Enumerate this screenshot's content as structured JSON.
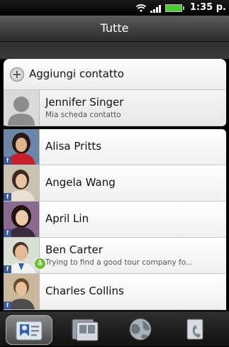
{
  "status_bar": {
    "time": "1:35 p."
  },
  "header": {
    "title": "Tutte"
  },
  "add_contact": {
    "label": "Aggiungi contatto"
  },
  "contacts": [
    {
      "name": "Jennifer Singer",
      "subtitle": "Mia scheda contatto",
      "source": "",
      "badge": ""
    },
    {
      "name": "Alisa Pritts",
      "subtitle": "",
      "source": "f",
      "badge": ""
    },
    {
      "name": "Angela Wang",
      "subtitle": "",
      "source": "f",
      "badge": ""
    },
    {
      "name": "April  Lin",
      "subtitle": "",
      "source": "f",
      "badge": ""
    },
    {
      "name": "Ben  Carter",
      "subtitle": "Trying to find a good tour company fo...",
      "source": "f",
      "badge": "1"
    },
    {
      "name": "Charles  Collins",
      "subtitle": "",
      "source": "f",
      "badge": ""
    }
  ],
  "bottom_tabs": [
    {
      "icon": "contacts-card-icon",
      "active": true
    },
    {
      "icon": "groups-icon",
      "active": false
    },
    {
      "icon": "online-directory-globe-icon",
      "active": false
    },
    {
      "icon": "call-history-phone-icon",
      "active": false
    }
  ],
  "colors": {
    "facebook": "#3b5998",
    "badge_green": "#3f9b12",
    "battery": "#4ecb2e"
  }
}
